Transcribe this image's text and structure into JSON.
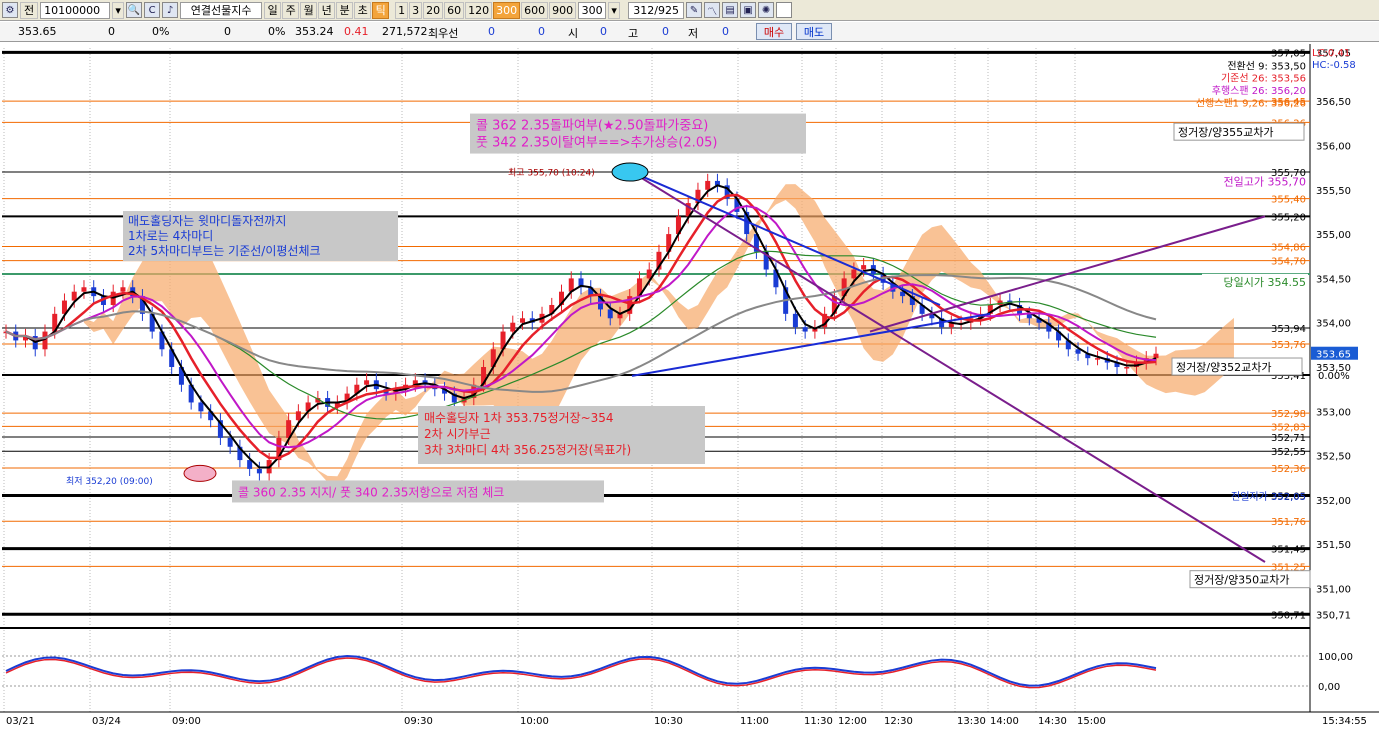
{
  "toolbar": {
    "tab_label": "전",
    "code": "10100000",
    "instrument": "연결선물지수",
    "periods": [
      "일",
      "주",
      "월",
      "년",
      "분",
      "초",
      "틱"
    ],
    "active_period": "틱",
    "tick_values": [
      "1",
      "3",
      "20",
      "60",
      "120",
      "300",
      "600",
      "900"
    ],
    "active_tick": "300",
    "tick_count": "300",
    "page_counter": "312/925"
  },
  "quote": {
    "current": "353.65",
    "v1": "0",
    "p1": "0%",
    "v2": "0",
    "p2": "0%",
    "price2": "353.24",
    "change": "0.41",
    "volume": "271,572",
    "best_label": "최우선",
    "b1": "0",
    "b2": "0",
    "open_label": "시",
    "open": "0",
    "high_label": "고",
    "high": "0",
    "low_label": "저",
    "low": "0",
    "buy_label": "매수",
    "sell_label": "매도"
  },
  "colors": {
    "orange_level": "#f26a00",
    "black_level": "#000000",
    "green_level": "#3c9a6a",
    "candle_up": "#e6202a",
    "candle_down": "#1a3cd4",
    "purple_trend": "#7a1e8c",
    "blue_trend": "#1a2bd4",
    "annot_box": "#c8c8c8"
  },
  "chart_data": {
    "type": "candlestick",
    "y_range": [
      350.6,
      357.1
    ],
    "y_ticks": [
      "357,05",
      "356,50",
      "356,00",
      "355,50",
      "355,00",
      "354,50",
      "354,00",
      "353,50",
      "353,00",
      "352,50",
      "352,00",
      "351,50",
      "351,00",
      "350,71"
    ],
    "x_ticks": [
      "03/21",
      "03/24",
      "09:00",
      "09:30",
      "10:00",
      "10:30",
      "11:00",
      "11:30",
      "12:00",
      "12:30",
      "13:30",
      "14:00",
      "14:30",
      "15:00"
    ],
    "clock": "15:34:55",
    "lc_label": "LC:0.41",
    "hc_label": "HC:-0.58",
    "current_price": "353.65",
    "current_pct": "0.00%",
    "levels": [
      {
        "v": 357.05,
        "c": "black",
        "w": 3,
        "label": "357,05"
      },
      {
        "v": 356.5,
        "c": "orange",
        "w": 1,
        "label": "356,45"
      },
      {
        "v": 356.26,
        "c": "orange",
        "w": 1,
        "label": "356,26"
      },
      {
        "v": 355.7,
        "c": "black",
        "w": 1,
        "label": "355,70"
      },
      {
        "v": 355.4,
        "c": "orange",
        "w": 1,
        "label": "355,40"
      },
      {
        "v": 355.2,
        "c": "black",
        "w": 2,
        "label": "355,20"
      },
      {
        "v": 354.86,
        "c": "orange",
        "w": 1,
        "label": "354,86"
      },
      {
        "v": 354.7,
        "c": "orange",
        "w": 1,
        "label": "354,70"
      },
      {
        "v": 354.55,
        "c": "green",
        "w": 2,
        "label": ""
      },
      {
        "v": 353.94,
        "c": "black",
        "w": 1,
        "label": "353,94"
      },
      {
        "v": 353.76,
        "c": "orange",
        "w": 1,
        "label": "353,76"
      },
      {
        "v": 353.41,
        "c": "black",
        "w": 2,
        "label": "353,41"
      },
      {
        "v": 352.98,
        "c": "orange",
        "w": 1,
        "label": "352,98"
      },
      {
        "v": 352.83,
        "c": "orange",
        "w": 1,
        "label": "352,83"
      },
      {
        "v": 352.71,
        "c": "black",
        "w": 1,
        "label": "352,71"
      },
      {
        "v": 352.55,
        "c": "black",
        "w": 1,
        "label": "352,55"
      },
      {
        "v": 352.36,
        "c": "orange",
        "w": 1,
        "label": "352,36"
      },
      {
        "v": 352.05,
        "c": "black",
        "w": 3,
        "label": "352,05"
      },
      {
        "v": 351.76,
        "c": "orange",
        "w": 1,
        "label": "351,76"
      },
      {
        "v": 351.45,
        "c": "black",
        "w": 3,
        "label": "351,45"
      },
      {
        "v": 351.25,
        "c": "orange",
        "w": 1,
        "label": "351,25"
      },
      {
        "v": 350.71,
        "c": "black",
        "w": 3,
        "label": "350,71"
      }
    ],
    "right_labels": {
      "conv": "전환선 9: 353,50",
      "base": "기준선 26: 353,56",
      "lag": "후행스팬 26: 356,20",
      "lead": "선행스팬1 9,26: 356,26",
      "prev_high": "전일고가 355,70",
      "today_open": "당일시가  354.55",
      "prev_low": "전일저가 352,05",
      "box_355": "정거장/양355교차가",
      "box_352": "정거장/양352교차가",
      "box_350": "정거장/양350교차가"
    },
    "high_label": "최고 355,70 (10:24)",
    "low_label": "최저 352,20 (09:00)",
    "annotations": {
      "top_line1": "콜  362  2.35돌파여부(★2.50돌파가중요)",
      "top_line2": "풋  342  2.35이탈여부==>추가상승(2.05)",
      "left_line1": "매도홀딩자는 윗마디돌자전까지",
      "left_line2": "1차로는  4차마디",
      "left_line3": "2차  5차마디부트는  기준선/이평선체크",
      "mid_line1": "매수홀딩자  1차  353.75정거장~354",
      "mid_line2": "2차  시가부근",
      "mid_line3": "3차  3차마디  4차  356.25정거장(목표가)",
      "bottom_line": "콜  360  2.35  지지/  풋  340  2.35저항으로  저점  체크"
    },
    "close": [
      353.9,
      353.8,
      353.85,
      353.7,
      353.9,
      354.1,
      354.25,
      354.35,
      354.4,
      354.3,
      354.2,
      354.35,
      354.4,
      354.3,
      354.1,
      353.9,
      353.7,
      353.5,
      353.3,
      353.1,
      353.0,
      352.9,
      352.7,
      352.6,
      352.45,
      352.35,
      352.3,
      352.45,
      352.7,
      352.9,
      353.0,
      353.1,
      353.15,
      353.05,
      353.1,
      353.2,
      353.3,
      353.35,
      353.25,
      353.2,
      353.25,
      353.3,
      353.35,
      353.3,
      353.25,
      353.2,
      353.1,
      353.15,
      353.3,
      353.5,
      353.7,
      353.9,
      354.0,
      354.05,
      354.0,
      354.1,
      354.2,
      354.35,
      354.5,
      354.4,
      354.3,
      354.15,
      354.05,
      354.1,
      354.3,
      354.5,
      354.6,
      354.8,
      355.0,
      355.2,
      355.35,
      355.5,
      355.6,
      355.55,
      355.4,
      355.25,
      355.0,
      354.8,
      354.6,
      354.4,
      354.1,
      353.95,
      353.9,
      353.95,
      354.1,
      354.3,
      354.5,
      354.6,
      354.65,
      354.55,
      354.45,
      354.35,
      354.3,
      354.2,
      354.1,
      354.05,
      353.95,
      354.0,
      354.0,
      354.05,
      354.1,
      354.2,
      354.25,
      354.2,
      354.1,
      354.05,
      354.0,
      353.9,
      353.8,
      353.7,
      353.65,
      353.6,
      353.6,
      353.55,
      353.5,
      353.5,
      353.55,
      353.6,
      353.65
    ],
    "annotation_notes": "Ichimoku cloud, moving averages and bottom oscillator (100,00 / 0,00)",
    "osc_ticks": [
      "100,00",
      "0,00"
    ]
  }
}
